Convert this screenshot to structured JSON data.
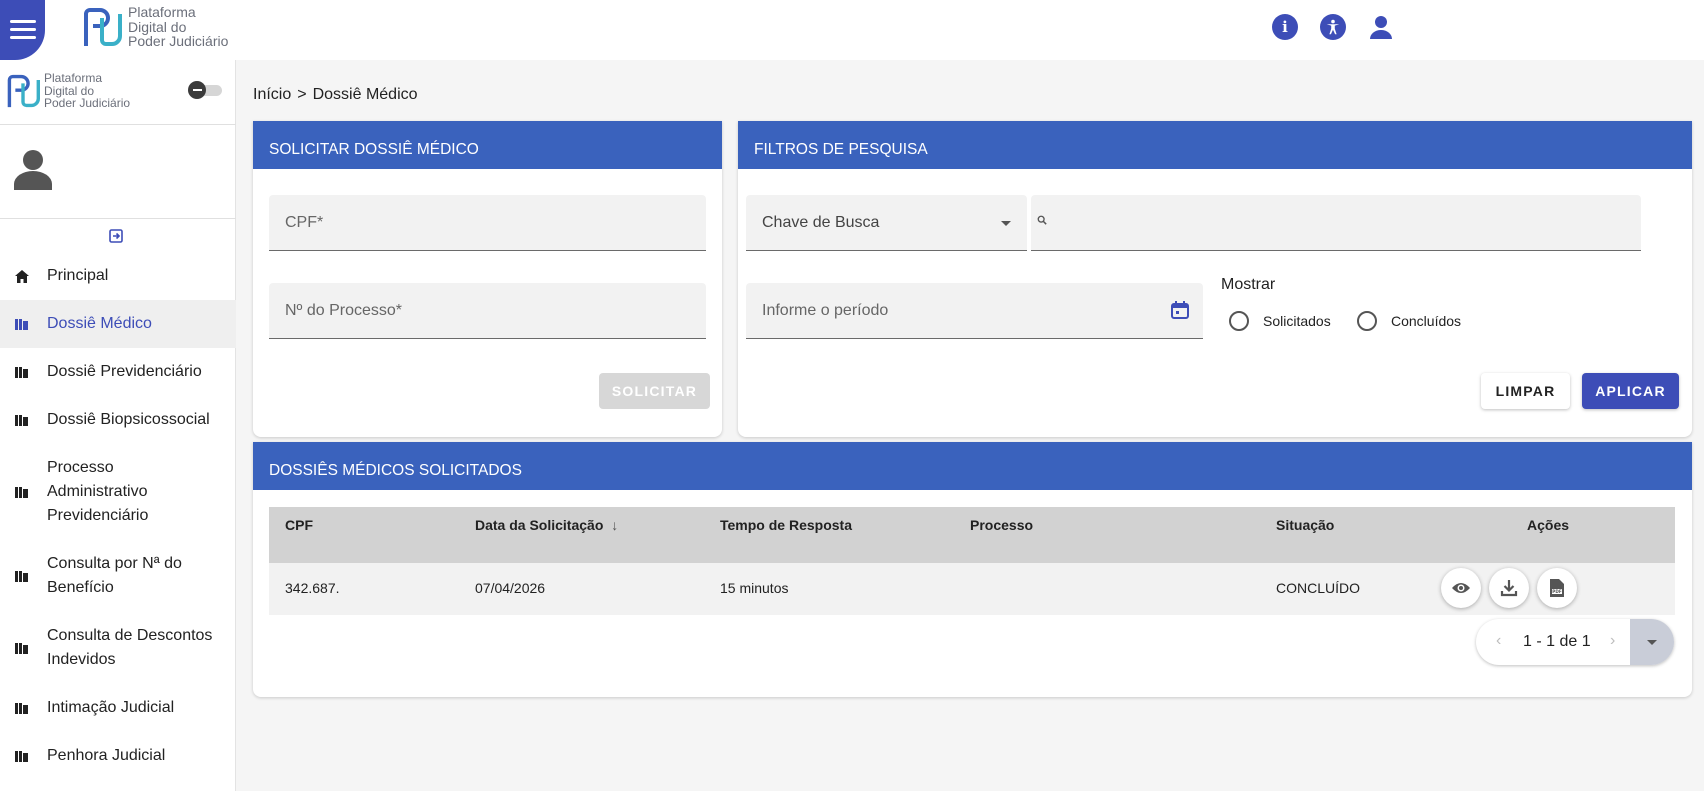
{
  "header": {
    "logo_lines": [
      "Plataforma",
      "Digital do",
      "Poder Judiciário"
    ],
    "icons": [
      "info-icon",
      "accessibility-icon",
      "user-icon"
    ]
  },
  "sidebar": {
    "logo_lines": [
      "Plataforma",
      "Digital do",
      "Poder Judiciário"
    ],
    "items": [
      {
        "label": "Principal",
        "icon": "home-icon"
      },
      {
        "label": "Dossiê Médico",
        "icon": "library-icon",
        "active": true
      },
      {
        "label": "Dossiê Previdenciário",
        "icon": "library-icon"
      },
      {
        "label": "Dossiê Biopsicossocial",
        "icon": "library-icon"
      },
      {
        "label": "Processo Administrativo Previdenciário",
        "lines": [
          "Processo",
          "Administrativo",
          "Previdenciário"
        ],
        "icon": "library-icon"
      },
      {
        "label": "Consulta por Nª do Benefício",
        "lines": [
          "Consulta por Nª do",
          "Benefício"
        ],
        "icon": "library-icon"
      },
      {
        "label": "Consulta de Descontos Indevidos",
        "lines": [
          "Consulta de Descontos",
          "Indevidos"
        ],
        "icon": "library-icon"
      },
      {
        "label": "Intimação Judicial",
        "icon": "library-icon"
      },
      {
        "label": "Penhora Judicial",
        "icon": "library-icon"
      }
    ]
  },
  "breadcrumb": {
    "home": "Início",
    "separator": ">",
    "current": "Dossiê Médico"
  },
  "solicitar": {
    "title": "SOLICITAR DOSSIÊ MÉDICO",
    "cpf_placeholder": "CPF*",
    "processo_placeholder": "Nº do Processo*",
    "submit_label": "SOLICITAR"
  },
  "filtros": {
    "title": "FILTROS DE PESQUISA",
    "chave_label": "Chave de Busca",
    "search_value": "",
    "periodo_placeholder": "Informe o período",
    "mostrar_label": "Mostrar",
    "options": [
      "Solicitados",
      "Concluídos"
    ],
    "clear_label": "LIMPAR",
    "apply_label": "APLICAR"
  },
  "table": {
    "title": "DOSSIÊS MÉDICOS SOLICITADOS",
    "columns": [
      "CPF",
      "Data da Solicitação",
      "Tempo de Resposta",
      "Processo",
      "Situação",
      "Ações"
    ],
    "sort_indicator": "↓",
    "rows": [
      {
        "cpf": "342.687.",
        "data": "07/04/2026",
        "tempo": "15 minutos",
        "processo": "",
        "situacao": "CONCLUÍDO"
      }
    ],
    "pagination": {
      "range": "1 - 1 de 1",
      "prev": "‹",
      "next": "›"
    }
  },
  "colors": {
    "primary": "#3d4db7",
    "header_blue": "#3a62bd"
  }
}
